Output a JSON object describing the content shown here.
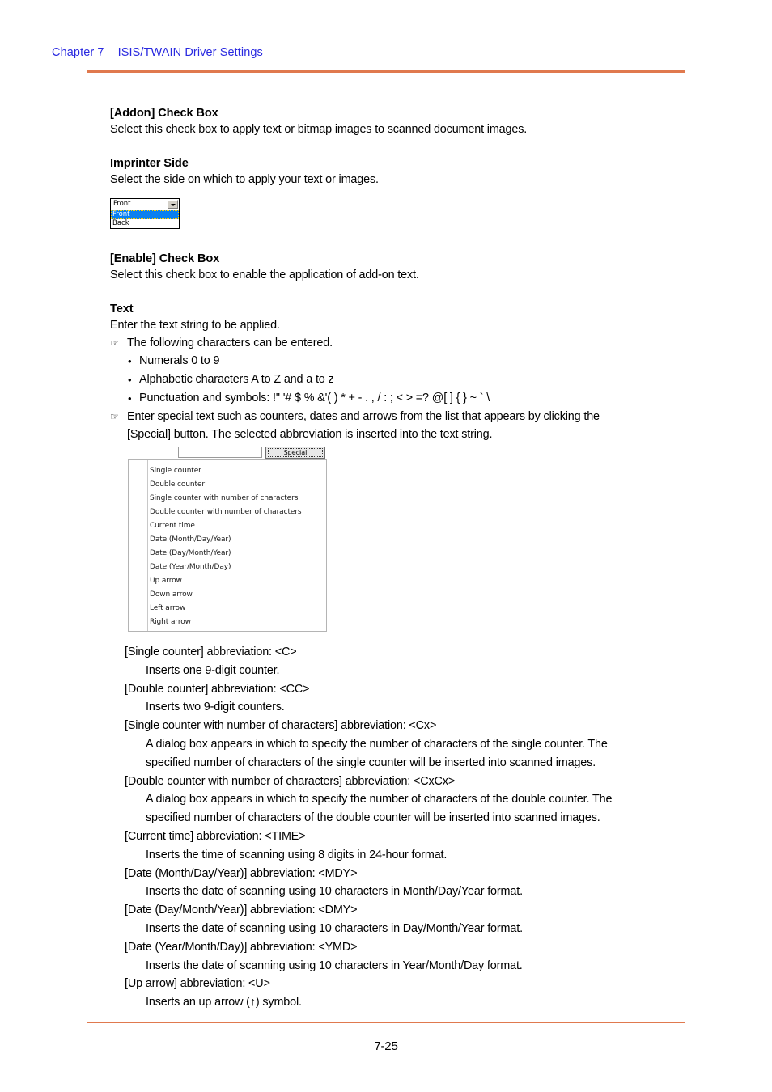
{
  "header": {
    "chapter": "Chapter 7",
    "title": "ISIS/TWAIN Driver Settings"
  },
  "footer": {
    "page_number": "7-25"
  },
  "colors": {
    "header_link": "#2a2ae0",
    "rule": "#e0794e",
    "selection_highlight": "#0a7ff0"
  },
  "sections": {
    "addon": {
      "heading": "[Addon] Check Box",
      "body": "Select this check box to apply text or bitmap images to scanned document images."
    },
    "imprinter": {
      "heading": "Imprinter Side",
      "body": "Select the side on which to apply your text or images."
    },
    "enable": {
      "heading": "[Enable] Check Box",
      "body": "Select this check box to enable the application of add-on text."
    },
    "text": {
      "heading": "Text",
      "body": "Enter the text string to be applied."
    }
  },
  "hand_items": {
    "first": "The following characters can be entered.",
    "second_line1": "Enter special text such as counters, dates and arrows from the list that appears by clicking the",
    "second_line2": "[Special] button. The selected abbreviation is inserted into the text string."
  },
  "char_bullets": [
    "Numerals 0 to 9",
    "Alphabetic characters A to Z and a to z",
    "Punctuation and symbols: !\" '# $ % &'( ) * + - . , / : ; < > =? @[ ] { } ~ ` \\"
  ],
  "combo_widget": {
    "value": "Front",
    "options": [
      "Front",
      "Back"
    ],
    "selected_index": 0,
    "arrow_icon": "chevron-down-icon"
  },
  "special_widget": {
    "input_value": "",
    "button_label": "Special",
    "menu_items": [
      "Single counter",
      "Double counter",
      "Single counter with number of characters",
      "Double counter with number of characters",
      "Current time",
      "Date (Month/Day/Year)",
      "Date (Day/Month/Year)",
      "Date (Year/Month/Day)",
      "Up arrow",
      "Down arrow",
      "Left arrow",
      "Right arrow"
    ]
  },
  "abbreviations": [
    {
      "term": "[Single counter] abbreviation: <C>",
      "defs": [
        "Inserts one 9-digit counter."
      ]
    },
    {
      "term": "[Double counter] abbreviation: <CC>",
      "defs": [
        "Inserts two 9-digit counters."
      ]
    },
    {
      "term": "[Single counter with number of characters] abbreviation: <Cx>",
      "defs": [
        "A dialog box appears in which to specify the number of characters of the single counter. The",
        "specified number of characters of the single counter will be inserted into scanned images."
      ]
    },
    {
      "term": "[Double counter with number of characters] abbreviation: <CxCx>",
      "defs": [
        "A dialog box appears in which to specify the number of characters of the double counter. The",
        "specified number of characters of the double counter will be inserted into scanned images."
      ]
    },
    {
      "term": "[Current time] abbreviation: <TIME>",
      "defs": [
        "Inserts the time of scanning using 8 digits in 24-hour format."
      ]
    },
    {
      "term": "[Date (Month/Day/Year)] abbreviation: <MDY>",
      "defs": [
        "Inserts the date of scanning using 10 characters in Month/Day/Year format."
      ]
    },
    {
      "term": "[Date (Day/Month/Year)] abbreviation: <DMY>",
      "defs": [
        "Inserts the date of scanning using 10 characters in Day/Month/Year format."
      ]
    },
    {
      "term": "[Date (Year/Month/Day)] abbreviation: <YMD>",
      "defs": [
        "Inserts the date of scanning using 10 characters in Year/Month/Day format."
      ]
    },
    {
      "term": "[Up arrow] abbreviation: <U>",
      "defs": [
        "Inserts an up arrow (↑) symbol."
      ]
    }
  ]
}
